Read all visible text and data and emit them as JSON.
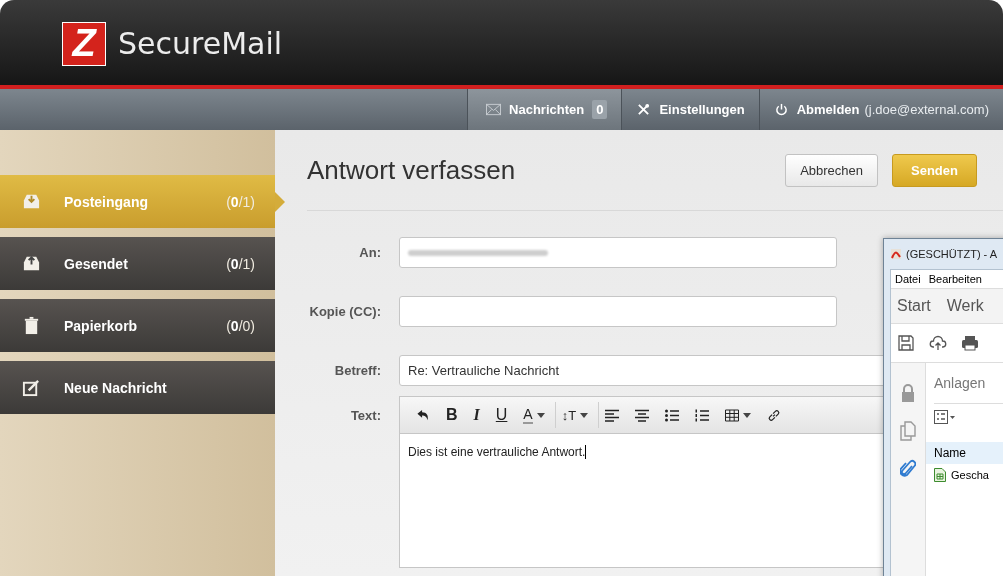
{
  "app": {
    "logo_letter": "Z",
    "name": "SecureMail"
  },
  "nav": [
    {
      "kind": "messages",
      "label": "Nachrichten",
      "badge": "0",
      "selected": true
    },
    {
      "kind": "settings",
      "label": "Einstellungen",
      "selected": false
    },
    {
      "kind": "logout",
      "label": "Abmelden",
      "detail": "(j.doe@external.com)",
      "selected": false
    }
  ],
  "sidebar": {
    "items": [
      {
        "kind": "inbox",
        "label": "Posteingang",
        "count": "(**0**/1)",
        "selected": true
      },
      {
        "kind": "sent",
        "label": "Gesendet",
        "count": "(**0**/1)",
        "selected": false
      },
      {
        "kind": "trash",
        "label": "Papierkorb",
        "count": "(**0**/0)",
        "selected": false
      },
      {
        "kind": "compose",
        "label": "Neue Nachricht",
        "selected": false
      }
    ]
  },
  "compose": {
    "title": "Antwort verfassen",
    "buttons": [
      {
        "kind": "secondary",
        "label": "Abbrechen"
      },
      {
        "kind": "primary",
        "label": "Senden"
      }
    ],
    "fields": [
      {
        "label": "An:",
        "redacted": true
      },
      {
        "label": "Kopie (CC):"
      },
      {
        "label": "Betreff:",
        "value": "Re: Vertrauliche Nachricht"
      }
    ],
    "body_label": "Text:",
    "toolbar": [
      {
        "kind": "undo"
      },
      {
        "kind": "bold",
        "label": "B"
      },
      {
        "kind": "italic",
        "label": "I"
      },
      {
        "kind": "underline",
        "label": "U"
      },
      {
        "kind": "color",
        "label": "A",
        "dropdown": true
      },
      {
        "kind": "size",
        "label": "↕T",
        "dropdown": true
      },
      {
        "kind": "align-left"
      },
      {
        "kind": "align-center"
      },
      {
        "kind": "bullets"
      },
      {
        "kind": "numbers"
      },
      {
        "kind": "table",
        "dropdown": true
      },
      {
        "kind": "link"
      }
    ],
    "body": "Dies ist eine vertrauliche Antwort."
  },
  "pdf_window": {
    "title": "(GESCHÜTZT) - A",
    "menu": [
      "Datei",
      "Bearbeiten"
    ],
    "tabs": [
      "Start",
      "Werk"
    ],
    "side_icons": [
      {
        "kind": "lock",
        "selected": false
      },
      {
        "kind": "pages",
        "selected": false
      },
      {
        "kind": "attachments",
        "selected": true
      }
    ],
    "panel_title": "Anlagen",
    "column": "Name",
    "files": [
      "Gescha"
    ]
  }
}
